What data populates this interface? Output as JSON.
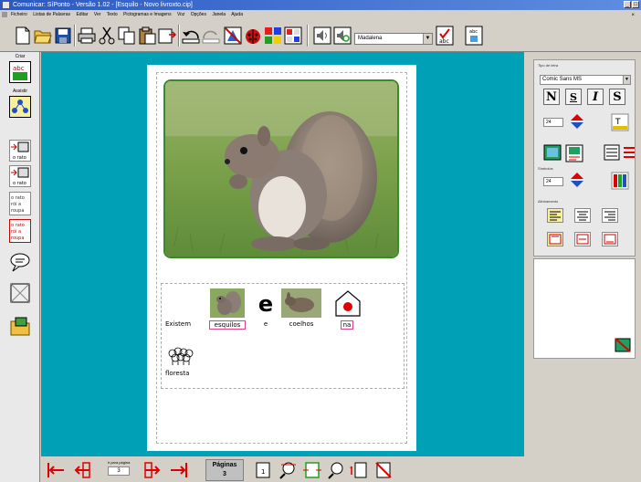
{
  "window": {
    "title": "Comunicar: SíPonto - Versão 1.02 - [Esquilo - Novo livroxto.cip]",
    "buttons": [
      "_",
      "□",
      "×"
    ]
  },
  "menu": {
    "items": [
      "Ficheiro",
      "Listas de Palavras",
      "Editar",
      "Ver",
      "Texto",
      "Pictogramas e Imagens",
      "Voz",
      "Opções",
      "Janela",
      "Ajuda"
    ]
  },
  "toolbar": {
    "voice_value": "Madalena",
    "tools": [
      "new-document",
      "open-folder",
      "save",
      "print",
      "cut",
      "copy",
      "paste",
      "insert",
      "undo",
      "redo",
      "clear-pictograms",
      "ladybug",
      "color-palette",
      "grid-layout",
      "speak",
      "speak-settings",
      "spell-check",
      "word-list"
    ]
  },
  "left_panel": {
    "label_criar": "Criar",
    "label_assistir": "Assistir",
    "buttons": [
      {
        "icon": "pictogram-text-icon",
        "label": "abc"
      },
      {
        "icon": "assist-grid-icon",
        "label": ""
      },
      {
        "icon": "to-text-icon",
        "label": "o rato"
      },
      {
        "icon": "to-picture-icon",
        "label": "o rato"
      },
      {
        "icon": "text-to-symbol-icon",
        "label": "o rato rói a roupa"
      },
      {
        "icon": "symbol-to-text-icon",
        "label": "o rato rói a roupa"
      },
      {
        "icon": "speech-bubble-icon",
        "label": ""
      },
      {
        "icon": "frame-icon",
        "label": ""
      },
      {
        "icon": "image-folder-icon",
        "label": ""
      }
    ]
  },
  "document": {
    "symbols": [
      {
        "word": "Existem",
        "has_picture": false
      },
      {
        "word": "esquilos",
        "has_picture": true,
        "picture": "squirrel",
        "selected": true
      },
      {
        "word": "e",
        "has_picture": true,
        "picture": "letter-e"
      },
      {
        "word": "coelhos",
        "has_picture": true,
        "picture": "rabbit"
      },
      {
        "word": "na",
        "has_picture": true,
        "picture": "in-house",
        "selected": true
      },
      {
        "word": "floresta",
        "has_picture": true,
        "picture": "forest"
      }
    ],
    "letter_e": "e"
  },
  "bottom": {
    "spin_label": "Ir para página",
    "spin_value": "3",
    "pages_label": "Páginas",
    "pages_value": "3"
  },
  "right_panel": {
    "font_group_label": "Tipo de letra",
    "font_value": "Comic Sans MS",
    "style_buttons": [
      "N",
      "S",
      "I",
      "S"
    ],
    "font_size_value": "24",
    "symbol_group_label": "Símbolos",
    "symbol_size_value": "24",
    "align_group_label": "Alinhamento"
  },
  "colors": {
    "canvas": "#00a0b6",
    "frame": "#3a8a2a",
    "selection": "#e0408a"
  }
}
